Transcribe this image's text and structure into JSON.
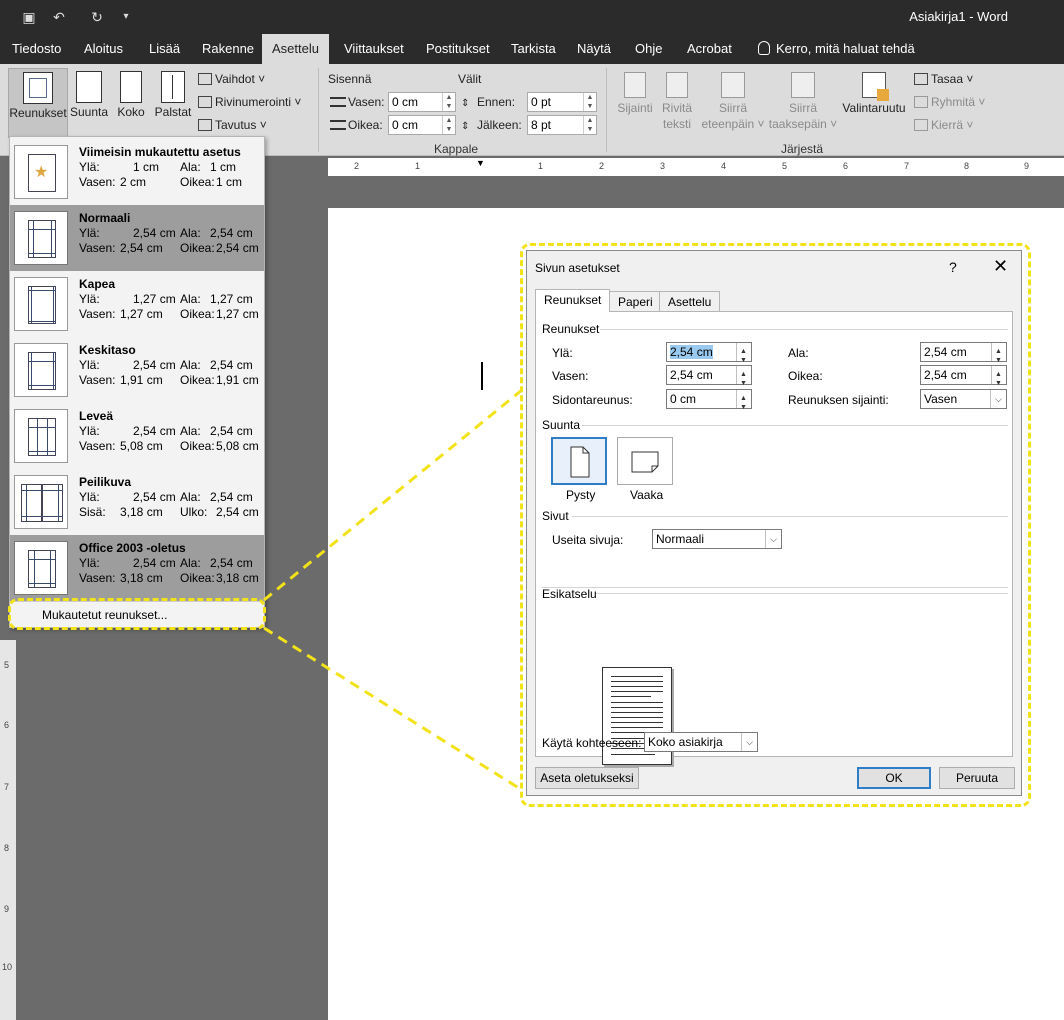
{
  "app": {
    "title": "Asiakirja1  -  Word"
  },
  "tabs": [
    {
      "label": "Tiedosto"
    },
    {
      "label": "Aloitus"
    },
    {
      "label": "Lisää"
    },
    {
      "label": "Rakenne"
    },
    {
      "label": "Asettelu"
    },
    {
      "label": "Viittaukset"
    },
    {
      "label": "Postitukset"
    },
    {
      "label": "Tarkista"
    },
    {
      "label": "Näytä"
    },
    {
      "label": "Ohje"
    },
    {
      "label": "Acrobat"
    }
  ],
  "tell_me": "Kerro, mitä haluat tehdä",
  "ribbon": {
    "margins": "Reunukset",
    "orientation": "Suunta",
    "size": "Koko",
    "columns": "Palstat",
    "breaks": "Vaihdot",
    "line_numbers": "Rivinumerointi",
    "hyphenation": "Tavutus",
    "indent_title": "Sisennä",
    "spacing_title": "Välit",
    "left_label": "Vasen:",
    "left_value": "0 cm",
    "right_label": "Oikea:",
    "right_value": "0 cm",
    "before_label": "Ennen:",
    "before_value": "0 pt",
    "after_label": "Jälkeen:",
    "after_value": "8 pt",
    "paragraph_group": "Kappale",
    "position_label": "Sijainti",
    "wrap_label_1": "Rivitä",
    "wrap_label_2": "teksti",
    "forward_label_1": "Siirrä",
    "forward_label_2": "eteenpäin",
    "backward_label_1": "Siirrä",
    "backward_label_2": "taaksepäin",
    "selection_pane": "Valintaruutu",
    "align": "Tasaa",
    "group": "Ryhmitä",
    "rotate": "Kierrä",
    "arrange_group": "Järjestä"
  },
  "ruler": {
    "ticks": [
      "2",
      "1",
      "1",
      "2",
      "3",
      "4",
      "5",
      "6",
      "7",
      "8",
      "9"
    ],
    "vticks": [
      "5",
      "6",
      "7",
      "8",
      "9",
      "10"
    ]
  },
  "margins_menu": {
    "options": [
      {
        "name": "Viimeisin mukautettu asetus",
        "l1": "Ylä:",
        "v1": "1 cm",
        "l2": "Ala:",
        "v2": "1 cm",
        "l3": "Vasen:",
        "v3": "2 cm",
        "l4": "Oikea:",
        "v4": "1 cm"
      },
      {
        "name": "Normaali",
        "l1": "Ylä:",
        "v1": "2,54 cm",
        "l2": "Ala:",
        "v2": "2,54 cm",
        "l3": "Vasen:",
        "v3": "2,54 cm",
        "l4": "Oikea:",
        "v4": "2,54 cm"
      },
      {
        "name": "Kapea",
        "l1": "Ylä:",
        "v1": "1,27 cm",
        "l2": "Ala:",
        "v2": "1,27 cm",
        "l3": "Vasen:",
        "v3": "1,27 cm",
        "l4": "Oikea:",
        "v4": "1,27 cm"
      },
      {
        "name": "Keskitaso",
        "l1": "Ylä:",
        "v1": "2,54 cm",
        "l2": "Ala:",
        "v2": "2,54 cm",
        "l3": "Vasen:",
        "v3": "1,91 cm",
        "l4": "Oikea:",
        "v4": "1,91 cm"
      },
      {
        "name": "Leveä",
        "l1": "Ylä:",
        "v1": "2,54 cm",
        "l2": "Ala:",
        "v2": "2,54 cm",
        "l3": "Vasen:",
        "v3": "5,08 cm",
        "l4": "Oikea:",
        "v4": "5,08 cm"
      },
      {
        "name": "Peilikuva",
        "l1": "Ylä:",
        "v1": "2,54 cm",
        "l2": "Ala:",
        "v2": "2,54 cm",
        "l3": "Sisä:",
        "v3": "3,18 cm",
        "l4": "Ulko:",
        "v4": "2,54 cm"
      },
      {
        "name": "Office 2003 -oletus",
        "l1": "Ylä:",
        "v1": "2,54 cm",
        "l2": "Ala:",
        "v2": "2,54 cm",
        "l3": "Vasen:",
        "v3": "3,18 cm",
        "l4": "Oikea:",
        "v4": "3,18 cm"
      }
    ],
    "custom": "Mukautetut reunukset..."
  },
  "dialog": {
    "title": "Sivun asetukset",
    "help": "?",
    "close": "✕",
    "tabs": [
      "Reunukset",
      "Paperi",
      "Asettelu"
    ],
    "margins_section": "Reunukset",
    "top_label": "Ylä:",
    "top_value": "2,54 cm",
    "bottom_label": "Ala:",
    "bottom_value": "2,54 cm",
    "left_label": "Vasen:",
    "left_value": "2,54 cm",
    "right_label": "Oikea:",
    "right_value": "2,54 cm",
    "gutter_label": "Sidontareunus:",
    "gutter_value": "0 cm",
    "gutter_pos_label": "Reunuksen sijainti:",
    "gutter_pos_value": "Vasen",
    "orientation_section": "Suunta",
    "portrait": "Pysty",
    "landscape": "Vaaka",
    "pages_section": "Sivut",
    "multiple_pages_label": "Useita sivuja:",
    "multiple_pages_value": "Normaali",
    "preview_section": "Esikatselu",
    "apply_to_label": "Käytä kohteeseen:",
    "apply_to_value": "Koko asiakirja",
    "set_default": "Aseta oletukseksi",
    "ok": "OK",
    "cancel": "Peruuta"
  },
  "colors": {
    "highlight": "#f2e21a",
    "accent": "#2f7dc6"
  }
}
